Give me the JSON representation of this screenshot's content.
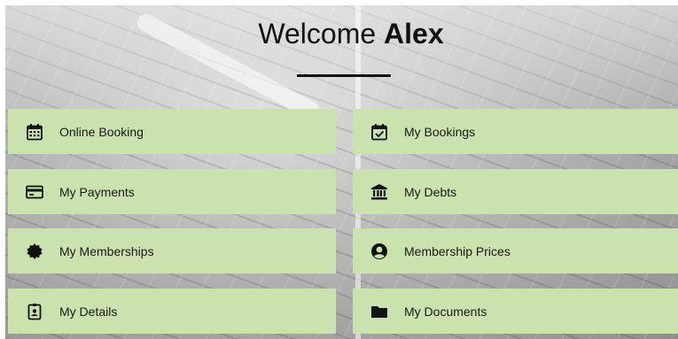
{
  "header": {
    "welcome_prefix": "Welcome",
    "user_name": "Alex"
  },
  "tiles": [
    {
      "label": "Online Booking",
      "icon": "calendar-grid-icon"
    },
    {
      "label": "My Bookings",
      "icon": "calendar-check-icon"
    },
    {
      "label": "My Payments",
      "icon": "credit-card-icon"
    },
    {
      "label": "My Debts",
      "icon": "bank-icon"
    },
    {
      "label": "My Memberships",
      "icon": "badge-icon"
    },
    {
      "label": "Membership Prices",
      "icon": "account-circle-icon"
    },
    {
      "label": "My Details",
      "icon": "id-badge-icon"
    },
    {
      "label": "My Documents",
      "icon": "folder-icon"
    }
  ],
  "colors": {
    "tile_background": "#c9e2ae",
    "text": "#111111"
  }
}
